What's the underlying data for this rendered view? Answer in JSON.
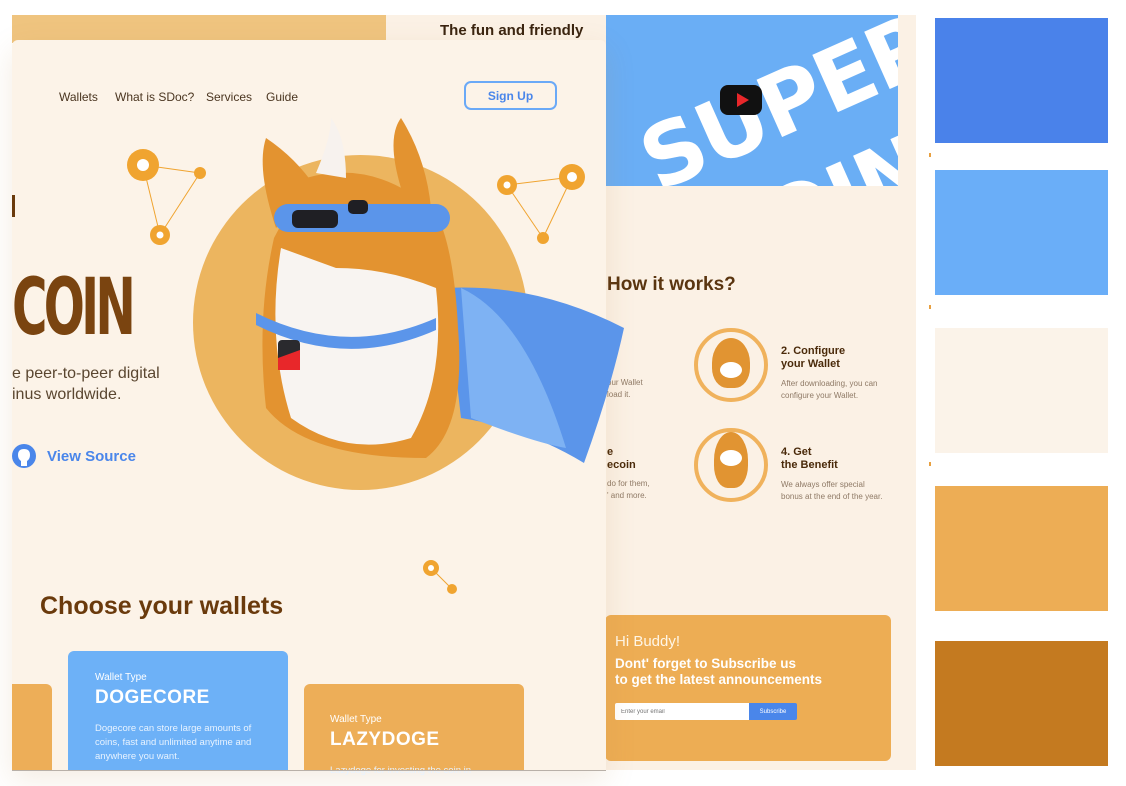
{
  "nav": {
    "items": [
      "Wallets",
      "What is SDoc?",
      "Services",
      "Guide"
    ],
    "signup": "Sign Up"
  },
  "hero": {
    "brand_fragment": "COIN",
    "tagline_line1": "e peer-to-peer digital",
    "tagline_line2": "inus worldwide.",
    "view_source": "View Source"
  },
  "wallets": {
    "title": "Choose your wallets",
    "cards": [
      {
        "type_label": "Wallet Type",
        "name": "DOGECORE",
        "description": "Dogecore can store large amounts of coins, fast and unlimited anytime and anywhere you want."
      },
      {
        "type_label": "Wallet Type",
        "name": "LAZYDOGE",
        "description": "Lazydoge for investing the coin in"
      }
    ]
  },
  "back": {
    "tagline": "The fun and friendly",
    "video_text_1": "SUPER",
    "video_text_2": "COIN",
    "how_title": "How it works?",
    "steps": [
      {
        "title_1": "2. Configure",
        "title_2": "your Wallet",
        "desc_1": "After downloading, you can",
        "desc_2": "configure your Wallet."
      },
      {
        "title_1": "4. Get",
        "title_2": "the Benefit",
        "desc_1": "We always offer special",
        "desc_2": "bonus at the end of the year."
      }
    ],
    "partial": {
      "a1": "our Wallet",
      "a2": "load it.",
      "b_title_1": "e",
      "b_title_2": "ecoin",
      "b1": "do for them,",
      "b2": "' and more."
    },
    "subscribe": {
      "greeting": "Hi Buddy!",
      "heading_1": "Dont' forget to Subscribe us",
      "heading_2": "to get the latest announcements",
      "email_placeholder": "Enter your email",
      "button": "Subscribe"
    }
  },
  "palette": [
    "#4a82ea",
    "#6aaef8",
    "#fbf3e9",
    "#edad55",
    "#c47a20"
  ]
}
